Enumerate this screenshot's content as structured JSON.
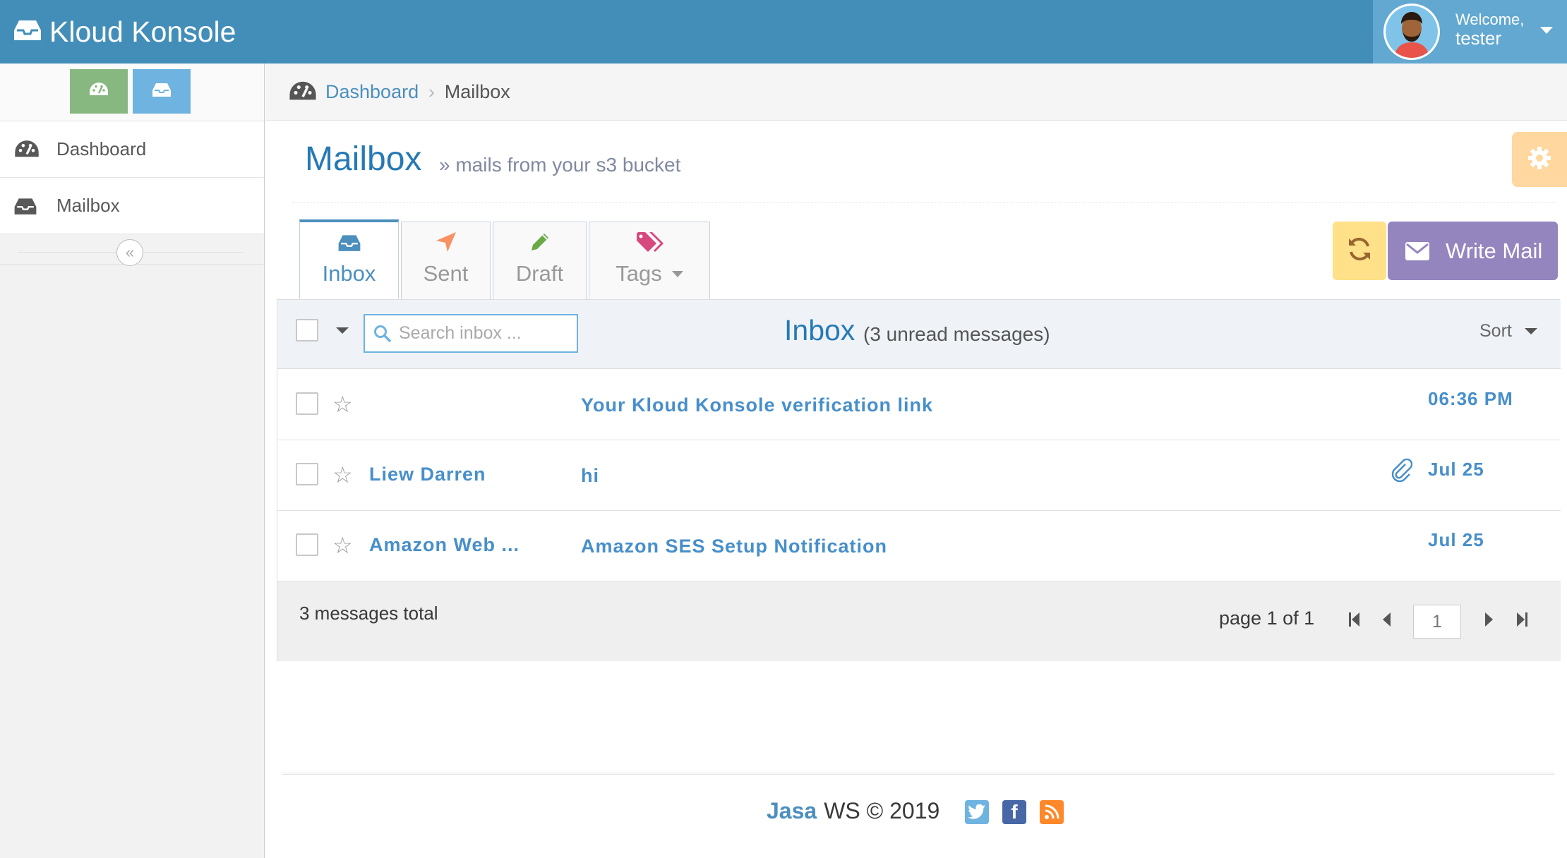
{
  "app": {
    "title": "Kloud Konsole"
  },
  "user": {
    "greeting": "Welcome,",
    "name": "tester"
  },
  "sidebar": {
    "items": [
      {
        "label": "Dashboard",
        "icon": "tachometer-icon"
      },
      {
        "label": "Mailbox",
        "icon": "inbox-icon"
      }
    ]
  },
  "breadcrumb": {
    "home": "Dashboard",
    "current": "Mailbox"
  },
  "page": {
    "title": "Mailbox",
    "subtitle": "» mails from your s3 bucket"
  },
  "tabs": [
    {
      "label": "Inbox",
      "icon": "inbox-icon",
      "active": true
    },
    {
      "label": "Sent",
      "icon": "location-arrow-icon"
    },
    {
      "label": "Draft",
      "icon": "pencil-icon"
    },
    {
      "label": "Tags",
      "icon": "tags-icon"
    }
  ],
  "toolbar": {
    "write_label": "Write Mail"
  },
  "list": {
    "search_placeholder": "Search inbox ...",
    "title": "Inbox",
    "unread": "(3 unread messages)",
    "sort_label": "Sort",
    "messages": [
      {
        "sender": "",
        "subject": "Your Kloud Konsole verification link",
        "time": "06:36 PM",
        "attachment": false
      },
      {
        "sender": "Liew Darren",
        "subject": "hi",
        "time": "Jul 25",
        "attachment": true
      },
      {
        "sender": "Amazon Web ...",
        "subject": "Amazon SES Setup Notification",
        "time": "Jul 25",
        "attachment": false
      }
    ],
    "total": "3 messages total",
    "page_label": "page 1 of 1",
    "page_value": "1"
  },
  "footer": {
    "brand": "Jasa",
    "text": "WS © 2019"
  },
  "colors": {
    "navbar": "#438eb9",
    "accent": "#4c8fbd",
    "write_button": "#9585bf",
    "refresh_button": "#fee188",
    "settings_button": "#ffb752"
  }
}
